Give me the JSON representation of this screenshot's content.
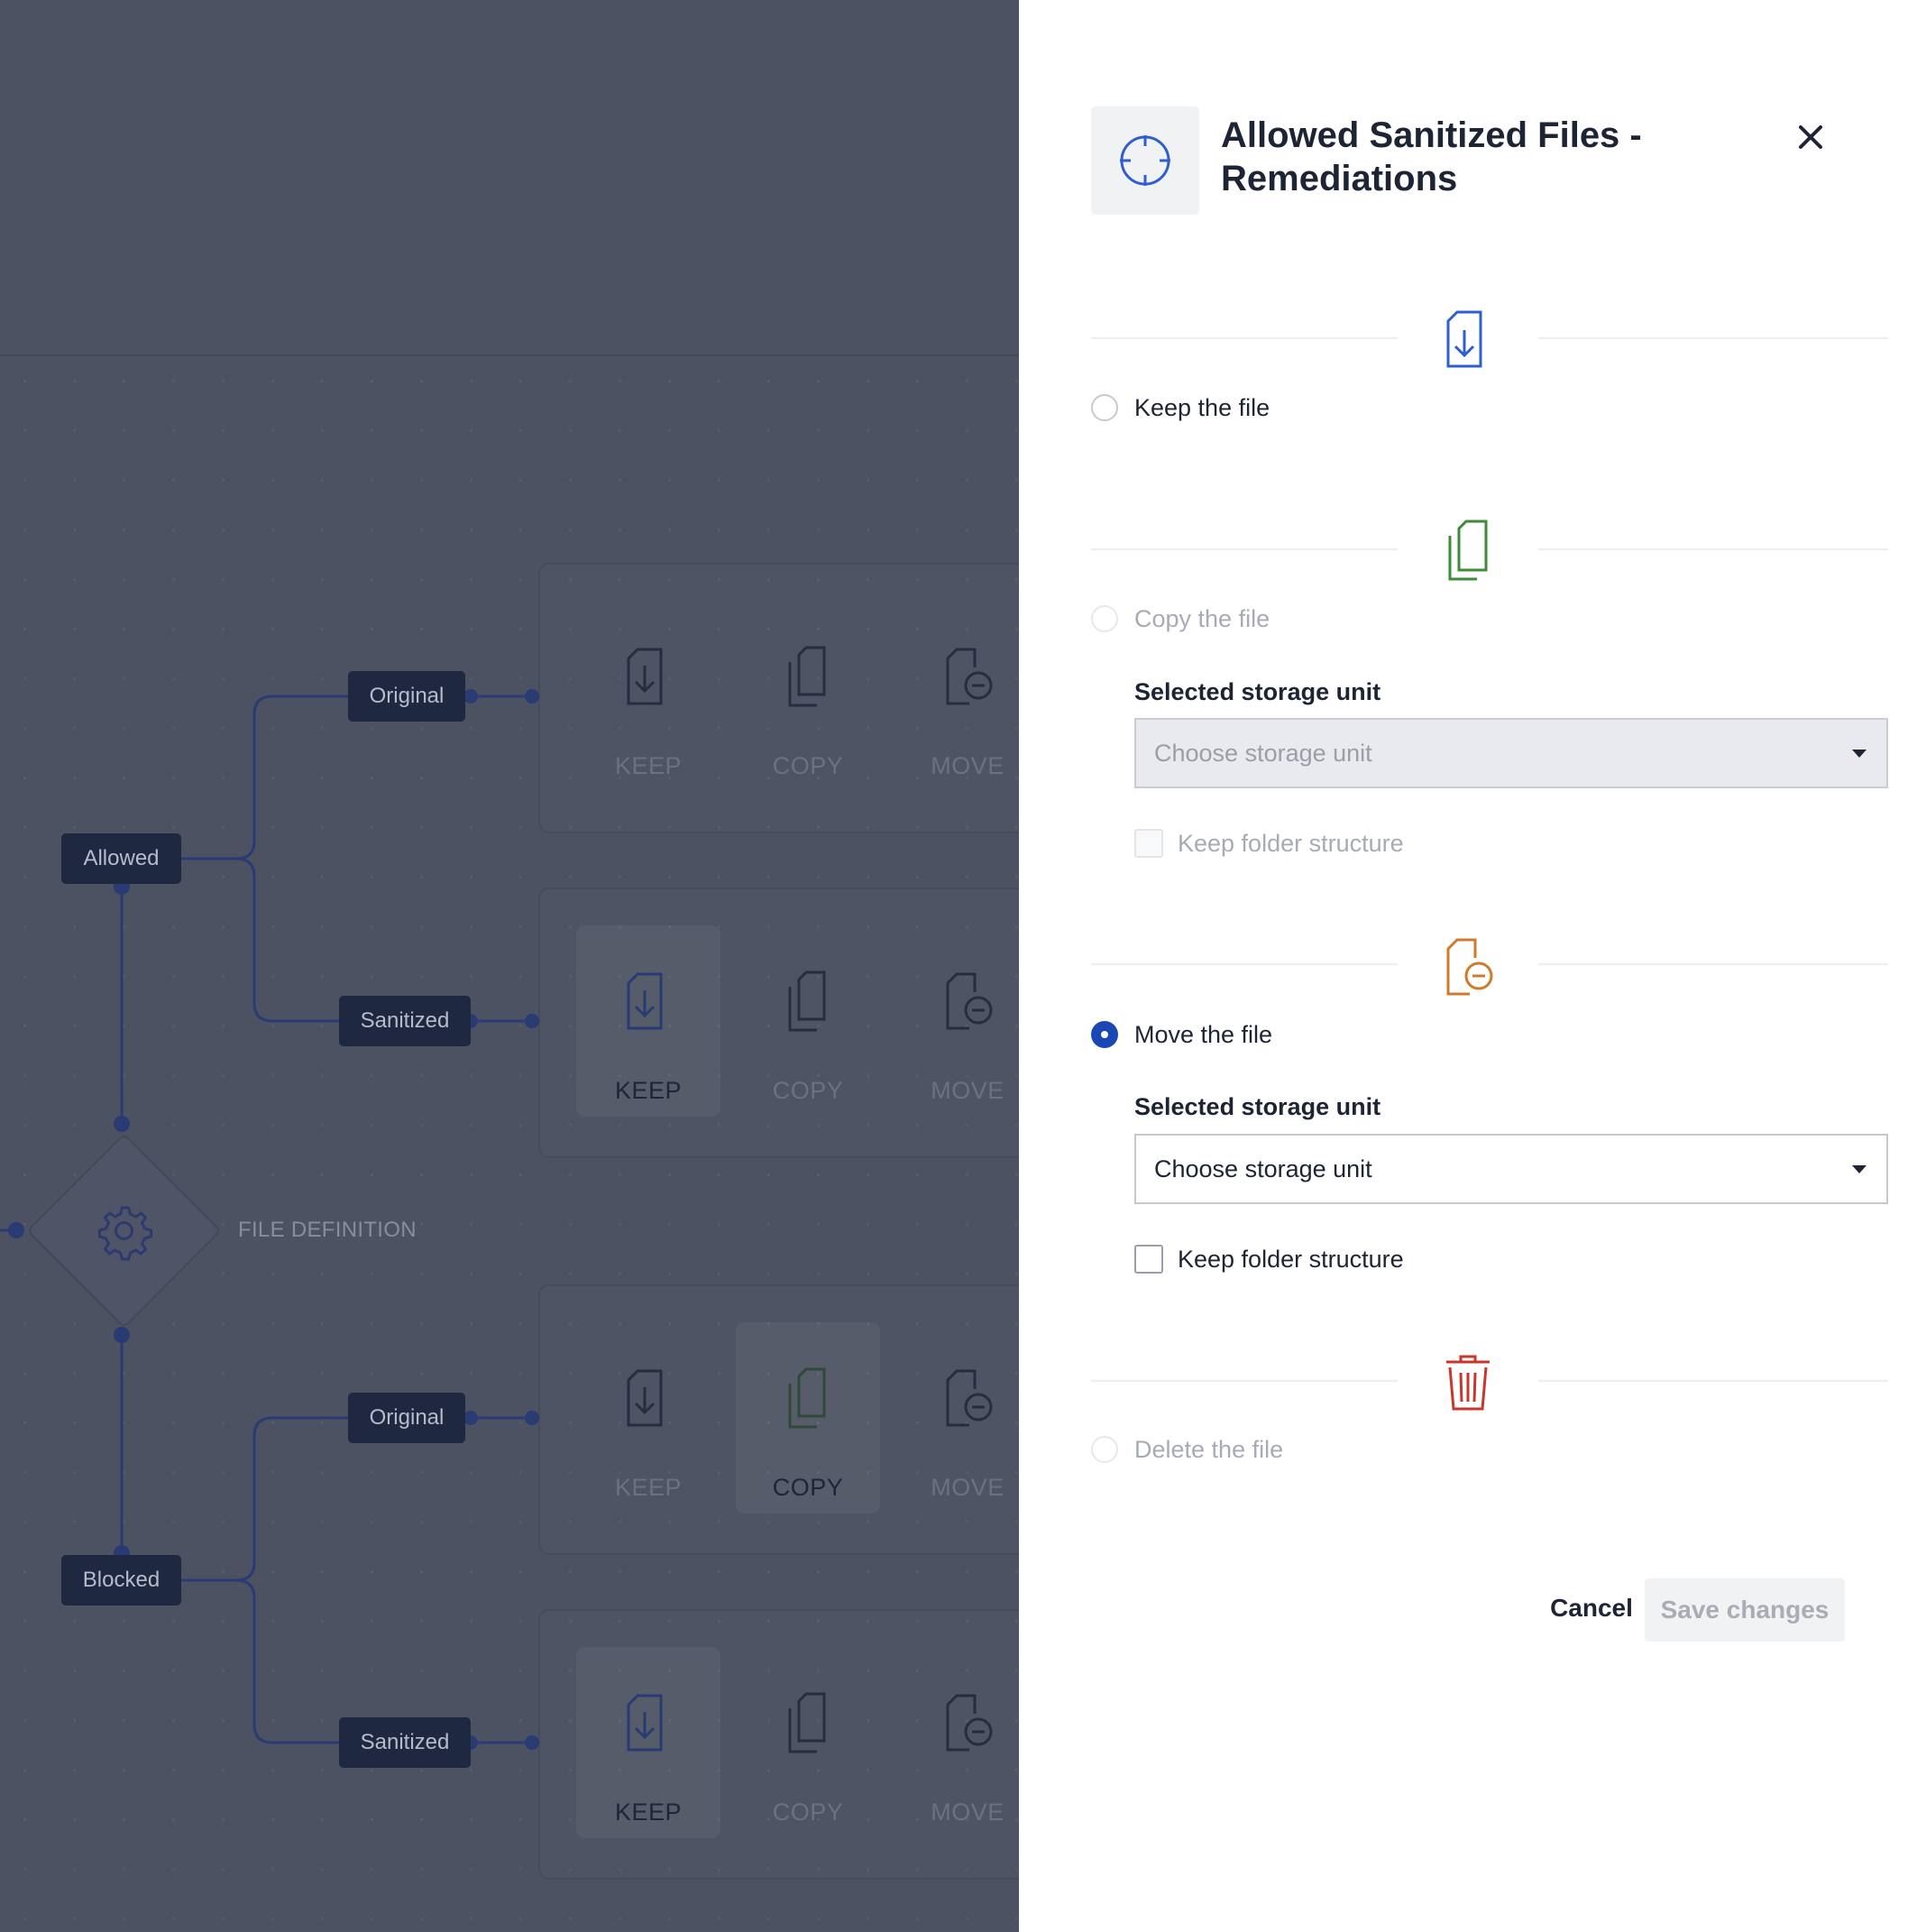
{
  "workflow": {
    "node_label": "FILE DEFINITION",
    "branches": [
      {
        "label": "Allowed",
        "outputs": [
          {
            "label": "Original",
            "actions": {
              "keep": "KEEP",
              "copy": "COPY",
              "move": "MOVE"
            },
            "selected": "none"
          },
          {
            "label": "Sanitized",
            "actions": {
              "keep": "KEEP",
              "copy": "COPY",
              "move": "MOVE"
            },
            "selected": "keep"
          }
        ]
      },
      {
        "label": "Blocked",
        "outputs": [
          {
            "label": "Original",
            "actions": {
              "keep": "KEEP",
              "copy": "COPY",
              "move": "MOVE"
            },
            "selected": "copy"
          },
          {
            "label": "Sanitized",
            "actions": {
              "keep": "KEEP",
              "copy": "COPY",
              "move": "MOVE"
            },
            "selected": "keep"
          }
        ]
      }
    ]
  },
  "panel": {
    "title": "Allowed Sanitized Files - Remediations",
    "header_icon": "crosshair-icon",
    "keep": {
      "label": "Keep the file",
      "checked": false,
      "disabled": false,
      "icon": "file-download-icon",
      "color": "#2f5fce"
    },
    "copy": {
      "label": "Copy the file",
      "checked": false,
      "disabled": true,
      "icon": "copy-files-icon",
      "color": "#3f8a3a",
      "storage_label": "Selected storage unit",
      "storage_placeholder": "Choose storage unit",
      "folder_label": "Keep folder structure"
    },
    "move": {
      "label": "Move the file",
      "checked": true,
      "disabled": false,
      "icon": "file-move-icon",
      "color": "#d07a2e",
      "storage_label": "Selected storage unit",
      "storage_placeholder": "Choose storage unit",
      "folder_label": "Keep folder structure"
    },
    "delete": {
      "label": "Delete the file",
      "checked": false,
      "disabled": true,
      "icon": "trash-icon",
      "color": "#c8372d"
    },
    "cancel_label": "Cancel",
    "save_label": "Save changes"
  },
  "colors": {
    "accent": "#1b47b5",
    "overlay": "#4c5262",
    "tag_bg": "#1f2841"
  }
}
